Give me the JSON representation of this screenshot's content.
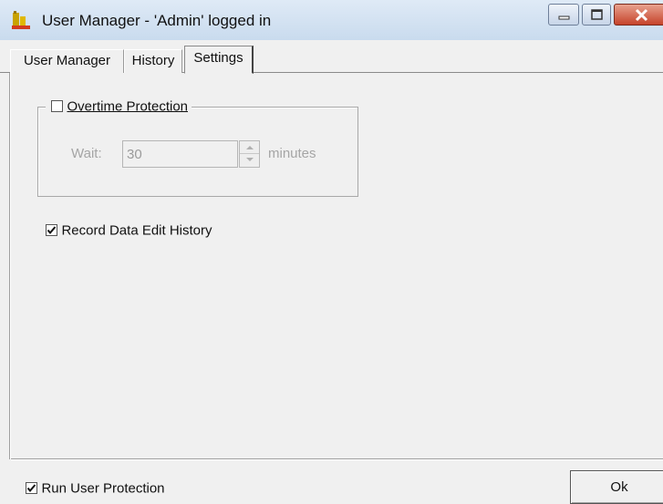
{
  "window": {
    "title": "User Manager - 'Admin' logged in"
  },
  "tabs": [
    {
      "label": "User Manager",
      "active": false
    },
    {
      "label": "History",
      "active": false
    },
    {
      "label": "Settings",
      "active": true
    }
  ],
  "settings": {
    "overtime_protection": {
      "label": "Overtime Protection",
      "checked": false,
      "wait_label": "Wait:",
      "wait_value": "30",
      "units_label": "minutes"
    },
    "record_history": {
      "label": "Record Data Edit History",
      "checked": true
    }
  },
  "footer": {
    "run_protection": {
      "label": "Run User Protection",
      "checked": true
    },
    "ok_label": "Ok"
  },
  "icons": {
    "app": "user-manager-app-icon",
    "minimize": "minimize-icon",
    "maximize": "maximize-icon",
    "close": "close-icon"
  }
}
